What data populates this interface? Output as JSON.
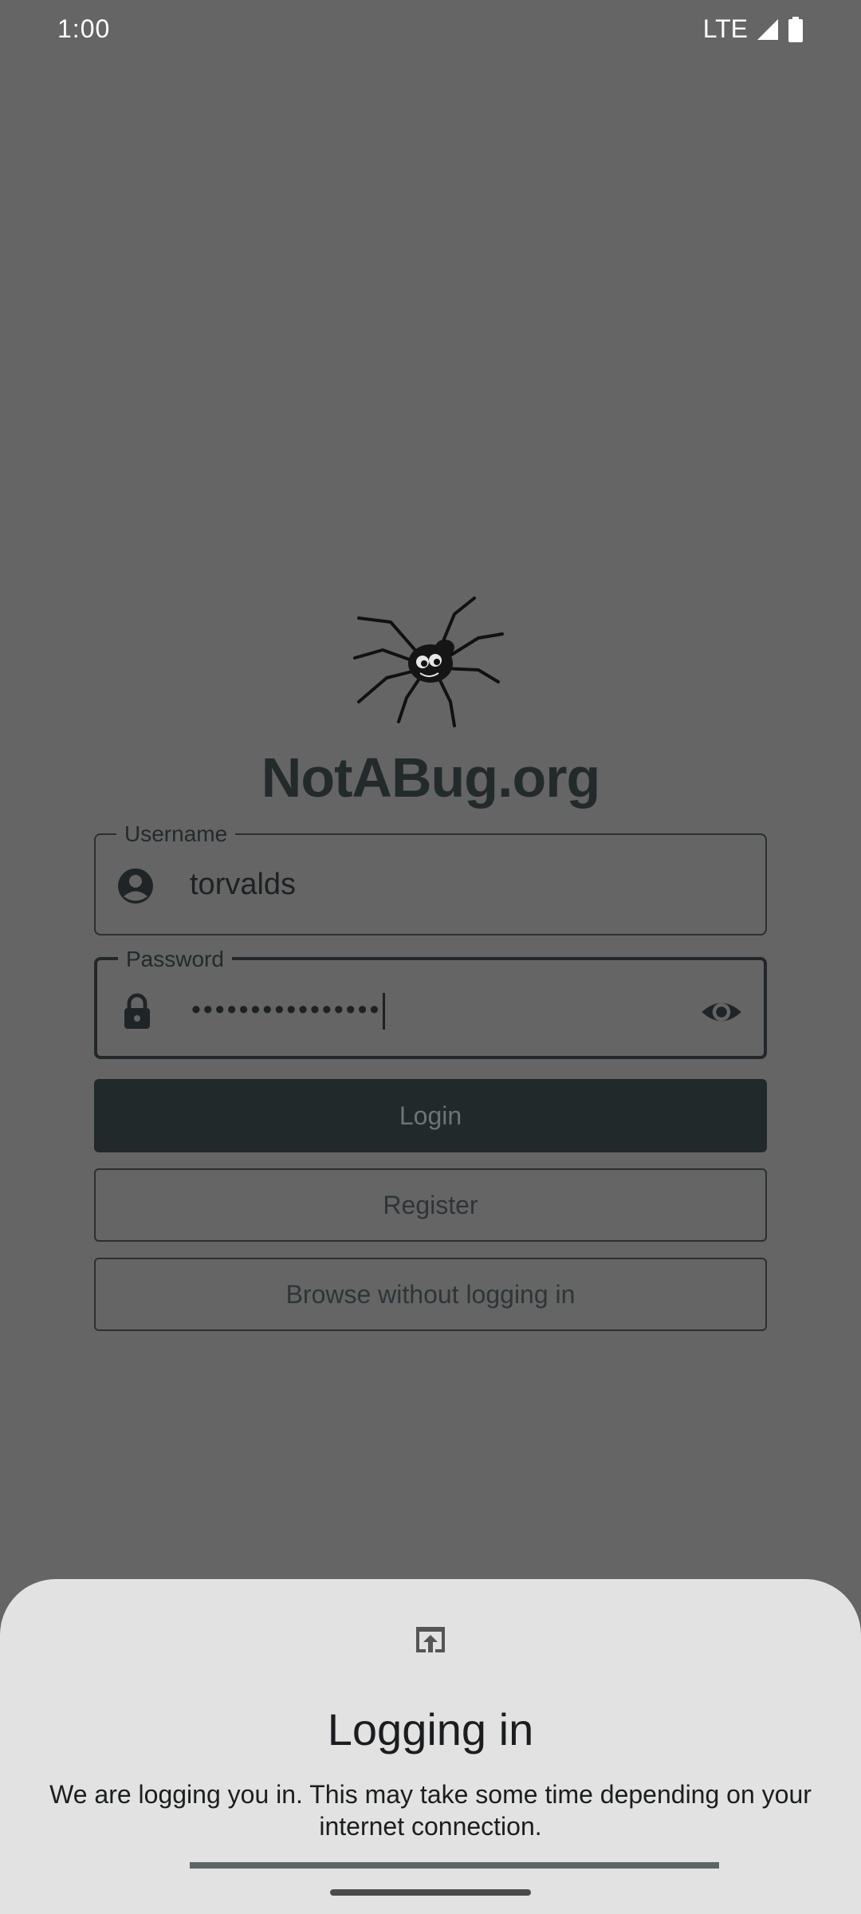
{
  "status_bar": {
    "time": "1:00",
    "network": "LTE"
  },
  "brand": {
    "name": "NotABug.org"
  },
  "form": {
    "username": {
      "label": "Username",
      "value": "torvalds"
    },
    "password": {
      "label": "Password",
      "value": "••••••••••••••••"
    }
  },
  "buttons": {
    "login": "Login",
    "register": "Register",
    "browse": "Browse without logging in"
  },
  "sheet": {
    "icon": "open-in-browser-icon",
    "title": "Logging in",
    "message": "We are logging you in. This may take some time depending on your internet connection."
  },
  "icons": {
    "username": "account-circle-icon",
    "password": "lock-icon",
    "toggle": "eye-icon"
  },
  "colors": {
    "background": "#656565",
    "brand_text": "#232a2b",
    "login_button": "#22292b",
    "sheet_background": "#e2e2e2",
    "progress": "#5a6666"
  }
}
